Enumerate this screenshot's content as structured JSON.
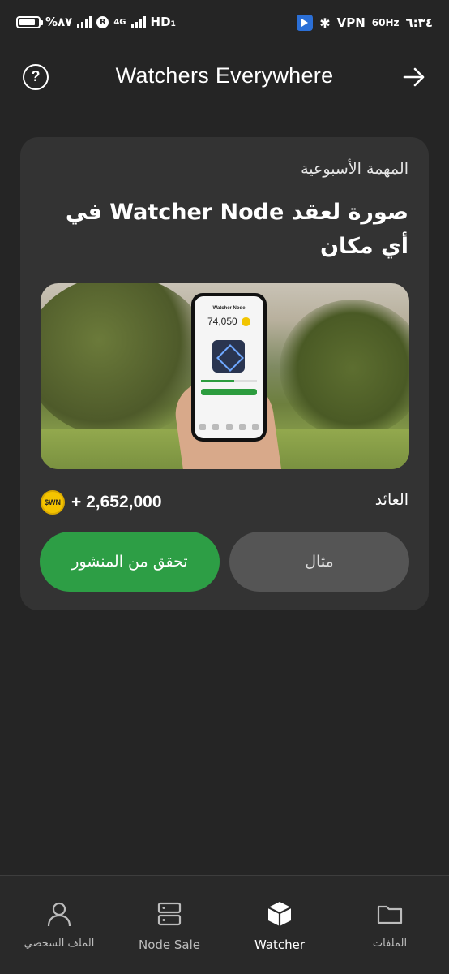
{
  "status_bar": {
    "battery_percent": "%٨٧",
    "battery_level": 0.87,
    "network_label": "4G",
    "hd_label": "HD₁",
    "vpn_label": "VPN",
    "refresh_rate": "60Hz",
    "time": "٦:٣٤"
  },
  "header": {
    "title": "Watchers Everywhere",
    "help_symbol": "?"
  },
  "card": {
    "label": "المهمة الأسبوعية",
    "title": "صورة لعقد Watcher Node في أي مكان",
    "hero_image": {
      "phone_title": "Watcher Node",
      "phone_amount": "74,050"
    },
    "reward_label": "العائد",
    "reward_value": "+ 2,652,000",
    "coin_symbol": "$WN",
    "verify_button": "تحقق من المنشور",
    "example_button": "مثال"
  },
  "bottom_nav": {
    "items": [
      {
        "label": "الملف الشخصي",
        "icon": "person-icon",
        "active": false
      },
      {
        "label": "Node Sale",
        "icon": "server-icon",
        "active": false
      },
      {
        "label": "Watcher",
        "icon": "cube-icon",
        "active": true
      },
      {
        "label": "الملفات",
        "icon": "folder-icon",
        "active": false
      }
    ]
  },
  "colors": {
    "background": "#252525",
    "card": "#333333",
    "accent_green": "#2d9e45",
    "secondary_button": "#555555",
    "coin": "#f4c400"
  }
}
